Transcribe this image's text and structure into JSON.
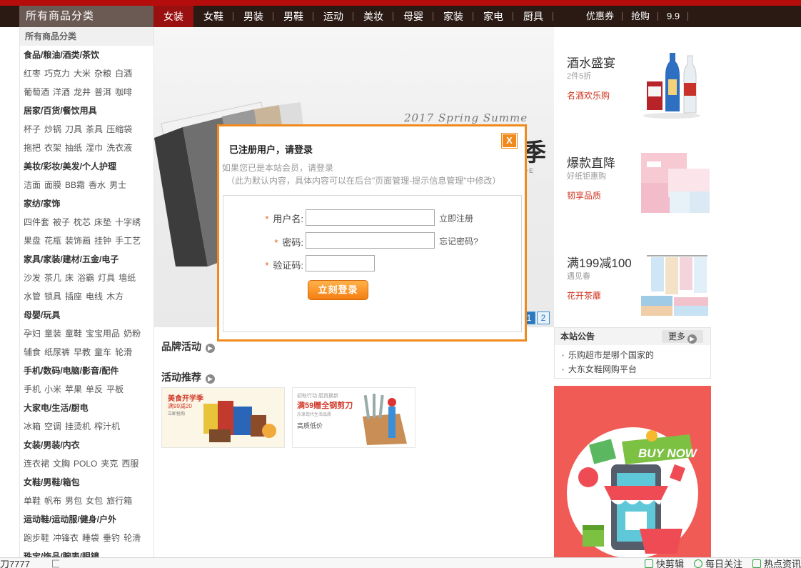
{
  "nav": {
    "category_label": "所有商品分类",
    "items": [
      "女装",
      "女鞋",
      "男装",
      "男鞋",
      "运动",
      "美妆",
      "母婴",
      "家装",
      "家电",
      "厨具",
      "优惠券",
      "抢购",
      "9.9"
    ]
  },
  "sidebar": {
    "header": "所有商品分类",
    "groups": [
      {
        "title": "食品/粮油/酒类/茶饮",
        "rows": [
          [
            "红枣",
            "巧克力",
            "大米",
            "杂粮",
            "白酒"
          ],
          [
            "葡萄酒",
            "洋酒",
            "龙井",
            "普洱",
            "咖啡"
          ]
        ]
      },
      {
        "title": "居家/百货/餐饮用具",
        "rows": [
          [
            "杯子",
            "炒锅",
            "刀具",
            "茶具",
            "压缩袋"
          ],
          [
            "拖把",
            "衣架",
            "抽纸",
            "湿巾",
            "洗衣液"
          ]
        ]
      },
      {
        "title": "美妆/彩妆/美发/个人护理",
        "rows": [
          [
            "洁面",
            "面膜",
            "BB霜",
            "香水",
            "男士"
          ]
        ]
      },
      {
        "title": "家纺/家饰",
        "rows": [
          [
            "四件套",
            "被子",
            "枕芯",
            "床垫",
            "十字绣"
          ],
          [
            "果盘",
            "花瓶",
            "装饰画",
            "挂钟",
            "手工艺"
          ]
        ]
      },
      {
        "title": "家具/家装/建材/五金/电子",
        "rows": [
          [
            "沙发",
            "茶几",
            "床",
            "浴霸",
            "灯具",
            "墙纸"
          ],
          [
            "水管",
            "锁具",
            "插座",
            "电线",
            "木方"
          ]
        ]
      },
      {
        "title": "母婴/玩具",
        "rows": [
          [
            "孕妇",
            "童装",
            "童鞋",
            "宝宝用品",
            "奶粉"
          ],
          [
            "辅食",
            "纸尿裤",
            "早教",
            "童车",
            "轮滑"
          ]
        ]
      },
      {
        "title": "手机/数码/电脑/影音/配件",
        "rows": [
          [
            "手机",
            "小米",
            "苹果",
            "单反",
            "平板"
          ]
        ]
      },
      {
        "title": "大家电/生活/厨电",
        "rows": [
          [
            "冰箱",
            "空调",
            "挂烫机",
            "榨汁机"
          ]
        ]
      },
      {
        "title": "女装/男装/内衣",
        "rows": [
          [
            "连衣裙",
            "文胸",
            "POLO",
            "夹克",
            "西服"
          ]
        ]
      },
      {
        "title": "女鞋/男鞋/箱包",
        "rows": [
          [
            "单鞋",
            "帆布",
            "男包",
            "女包",
            "旅行箱"
          ]
        ]
      },
      {
        "title": "运动鞋/运动服/健身/户外",
        "rows": [
          [
            "跑步鞋",
            "冲锋衣",
            "睡袋",
            "垂钓",
            "轮滑"
          ]
        ]
      },
      {
        "title": "珠宝/饰品/腕表/眼镜",
        "rows": []
      }
    ]
  },
  "hero": {
    "script_text": "2017 Spring Summe",
    "big_text": "季",
    "sub_text": "NDE",
    "pages": [
      "1",
      "2"
    ]
  },
  "promos": [
    {
      "title": "酒水盛宴",
      "subtitle": "2件5折",
      "link": "名酒欢乐购"
    },
    {
      "title": "爆款直降",
      "subtitle": "好纸钜惠购",
      "link": "韧享品质"
    },
    {
      "title": "满199减100",
      "subtitle": "遇见春",
      "link": "花开茶蘼"
    }
  ],
  "notice": {
    "title": "本站公告",
    "more": "更多",
    "items": [
      "乐购超市是哪个国家的",
      "大东女鞋网购平台"
    ]
  },
  "buy_now_text": "BUY NOW",
  "sections": {
    "brand": "品牌活动",
    "activity": "活动推荐"
  },
  "activity_cards": [
    {
      "line1": "美食开学季",
      "line2": "满99减20",
      "line3": "立即抢购"
    },
    {
      "line1": "初秋行动 厨具换新",
      "line2": "满59赠全钢剪刀",
      "line3": "乐享现代生活品质",
      "line4": "高质低价"
    }
  ],
  "modal": {
    "close": "X",
    "title": "已注册用户，请登录",
    "hint1": "如果您已是本站会员，请登录",
    "hint2": "（此为默认内容，具体内容可以在后台\"页面管理-提示信息管理\"中修改）",
    "required_mark": "*",
    "username_label": "用户名:",
    "password_label": "密码:",
    "captcha_label": "验证码:",
    "register_link": "立即注册",
    "forgot_link": "忘记密码?",
    "submit": "立刻登录"
  },
  "statusbar": {
    "left": "刀7777",
    "left2": "匚",
    "right": [
      "快剪辑",
      "每日关注",
      "热点资讯"
    ]
  },
  "colors": {
    "accent_orange": "#f08a1c",
    "nav_bg": "#2b1a14",
    "nav_active": "#9a0f0f",
    "promo_red": "#d0321e",
    "buy_now_bg": "#f05b55"
  }
}
